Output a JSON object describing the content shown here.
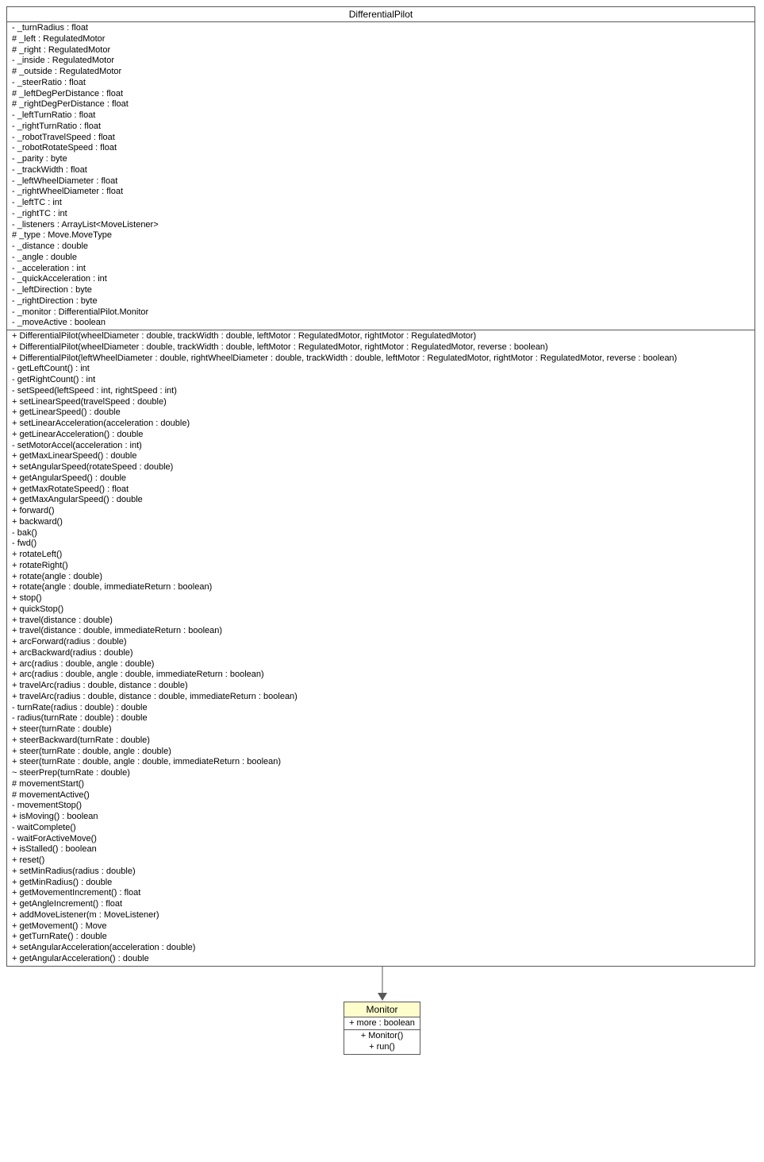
{
  "main": {
    "title": "DifferentialPilot",
    "attributes": [
      "- _turnRadius : float",
      "# _left : RegulatedMotor",
      "# _right : RegulatedMotor",
      "- _inside : RegulatedMotor",
      "# _outside : RegulatedMotor",
      "- _steerRatio : float",
      "# _leftDegPerDistance : float",
      "# _rightDegPerDistance : float",
      "- _leftTurnRatio : float",
      "- _rightTurnRatio : float",
      "- _robotTravelSpeed : float",
      "- _robotRotateSpeed : float",
      "- _parity : byte",
      "- _trackWidth : float",
      "- _leftWheelDiameter : float",
      "- _rightWheelDiameter : float",
      "- _leftTC : int",
      "- _rightTC : int",
      "- _listeners : ArrayList<MoveListener>",
      "# _type : Move.MoveType",
      "- _distance : double",
      "- _angle : double",
      "- _acceleration : int",
      "- _quickAcceleration : int",
      "- _leftDirection : byte",
      "- _rightDirection : byte",
      "- _monitor : DifferentialPilot.Monitor",
      "- _moveActive : boolean"
    ],
    "methods": [
      "+ DifferentialPilot(wheelDiameter : double, trackWidth : double, leftMotor : RegulatedMotor, rightMotor : RegulatedMotor)",
      "+ DifferentialPilot(wheelDiameter : double, trackWidth : double, leftMotor : RegulatedMotor, rightMotor : RegulatedMotor, reverse : boolean)",
      "+ DifferentialPilot(leftWheelDiameter : double, rightWheelDiameter : double, trackWidth : double, leftMotor : RegulatedMotor, rightMotor : RegulatedMotor, reverse : boolean)",
      "- getLeftCount() : int",
      "- getRightCount() : int",
      "- setSpeed(leftSpeed : int, rightSpeed : int)",
      "+ setLinearSpeed(travelSpeed : double)",
      "+ getLinearSpeed() : double",
      "+ setLinearAcceleration(acceleration : double)",
      "+ getLinearAcceleration() : double",
      "- setMotorAccel(acceleration : int)",
      "+ getMaxLinearSpeed() : double",
      "+ setAngularSpeed(rotateSpeed : double)",
      "+ getAngularSpeed() : double",
      "+ getMaxRotateSpeed() : float",
      "+ getMaxAngularSpeed() : double",
      "+ forward()",
      "+ backward()",
      "- bak()",
      "- fwd()",
      "+ rotateLeft()",
      "+ rotateRight()",
      "+ rotate(angle : double)",
      "+ rotate(angle : double, immediateReturn : boolean)",
      "+ stop()",
      "+ quickStop()",
      "+ travel(distance : double)",
      "+ travel(distance : double, immediateReturn : boolean)",
      "+ arcForward(radius : double)",
      "+ arcBackward(radius : double)",
      "+ arc(radius : double, angle : double)",
      "+ arc(radius : double, angle : double, immediateReturn : boolean)",
      "+ travelArc(radius : double, distance : double)",
      "+ travelArc(radius : double, distance : double, immediateReturn : boolean)",
      "- turnRate(radius : double) : double",
      "- radius(turnRate : double) : double",
      "+ steer(turnRate : double)",
      "+ steerBackward(turnRate : double)",
      "+ steer(turnRate : double, angle : double)",
      "+ steer(turnRate : double, angle : double, immediateReturn : boolean)",
      "~ steerPrep(turnRate : double)",
      "# movementStart()",
      "# movementActive()",
      "- movementStop()",
      "+ isMoving() : boolean",
      "- waitComplete()",
      "- waitForActiveMove()",
      "+ isStalled() : boolean",
      "+ reset()",
      "+ setMinRadius(radius : double)",
      "+ getMinRadius() : double",
      "+ getMovementIncrement() : float",
      "+ getAngleIncrement() : float",
      "+ addMoveListener(m : MoveListener)",
      "+ getMovement() : Move",
      "+ getTurnRate() : double",
      "+ setAngularAcceleration(acceleration : double)",
      "+ getAngularAcceleration() : double"
    ]
  },
  "monitor": {
    "title": "Monitor",
    "attributes": [
      "+ more : boolean"
    ],
    "methods": [
      "+ Monitor()",
      "+ run()"
    ]
  }
}
